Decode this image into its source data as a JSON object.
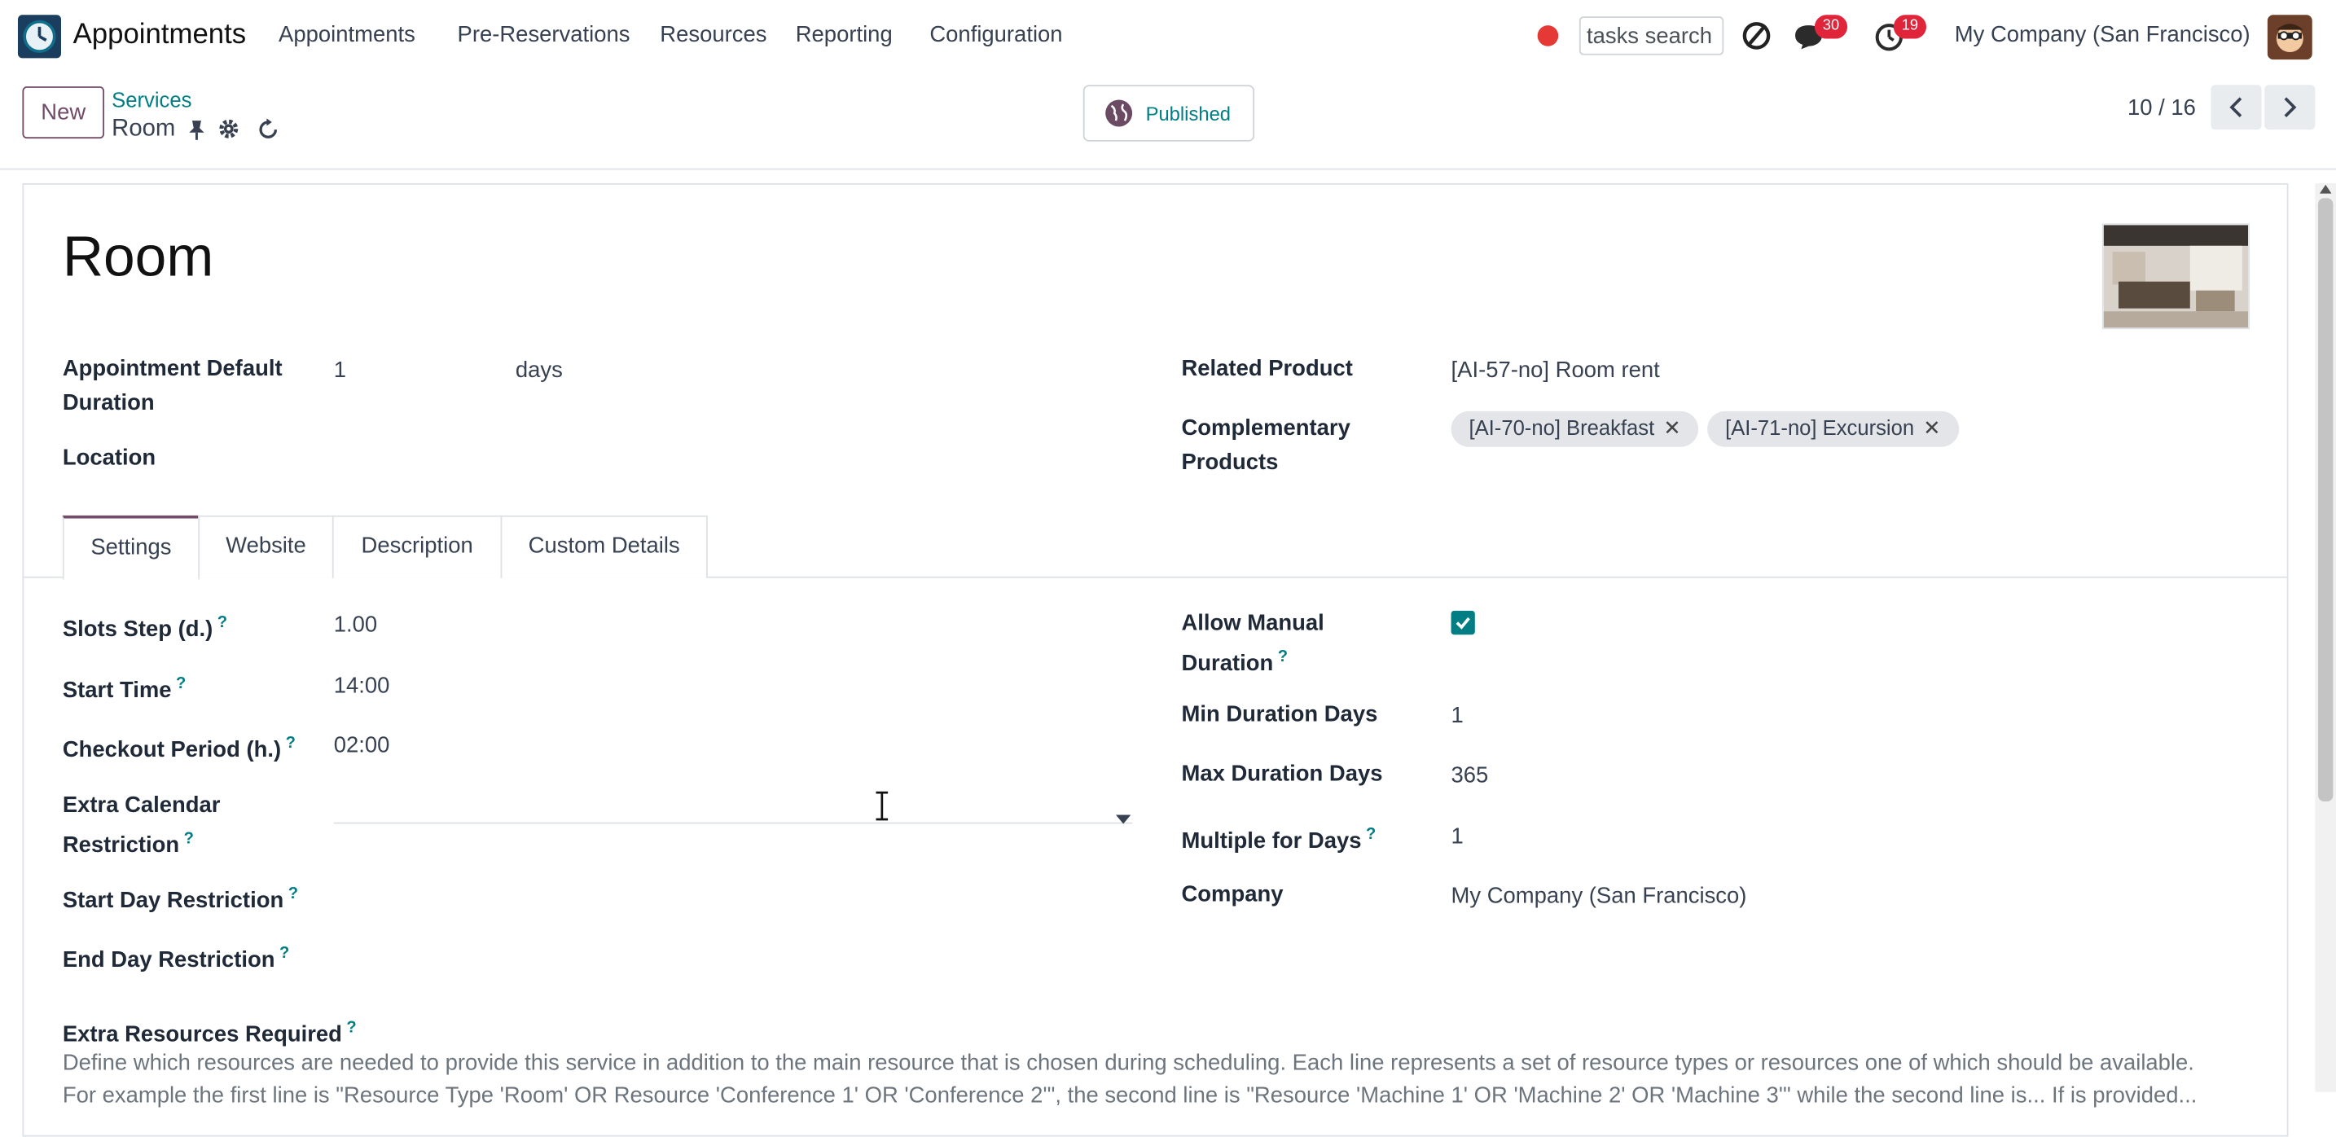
{
  "app": {
    "name": "Appointments",
    "menu": [
      "Appointments",
      "Pre-Reservations",
      "Resources",
      "Reporting",
      "Configuration"
    ],
    "search_value": "tasks search",
    "messages_count": "30",
    "activities_count": "19",
    "company": "My Company (San Francisco)"
  },
  "control": {
    "new_label": "New",
    "breadcrumb_parent": "Services",
    "breadcrumb_current": "Room",
    "published_label": "Published",
    "pager": "10 / 16"
  },
  "record": {
    "title": "Room",
    "left_fields": {
      "duration_label": "Appointment Default Duration",
      "duration_value": "1",
      "duration_unit": "days",
      "location_label": "Location"
    },
    "right_fields": {
      "related_product_label": "Related Product",
      "related_product_value": "[AI-57-no] Room rent",
      "complementary_label": "Complementary Products",
      "complementary_tags": [
        "[AI-70-no] Breakfast",
        "[AI-71-no] Excursion"
      ]
    }
  },
  "tabs": [
    "Settings",
    "Website",
    "Description",
    "Custom Details"
  ],
  "settings": {
    "left": [
      {
        "label": "Slots Step (d.)",
        "value": "1.00"
      },
      {
        "label": "Start Time",
        "value": "14:00"
      },
      {
        "label": "Checkout Period (h.)",
        "value": "02:00"
      },
      {
        "label": "Extra Calendar Restriction",
        "value": ""
      },
      {
        "label": "Start Day Restriction",
        "value": ""
      },
      {
        "label": "End Day Restriction",
        "value": ""
      }
    ],
    "right": [
      {
        "label": "Allow Manual Duration",
        "value": ""
      },
      {
        "label": "Min Duration Days",
        "value": "1"
      },
      {
        "label": "Max Duration Days",
        "value": "365"
      },
      {
        "label": "Multiple for Days",
        "value": "1"
      },
      {
        "label": "Company",
        "value": "My Company (San Francisco)"
      }
    ],
    "allow_manual_duration": true,
    "extra_resources_label": "Extra Resources Required",
    "extra_resources_description": "Define which resources are needed to provide this service in addition to the main resource that is chosen during scheduling. Each line represents a set of resource types or resources one of which should be available.",
    "extra_resources_description_cont": "For example the first line is \"Resource Type 'Room' OR Resource 'Conference 1' OR 'Conference 2'\", the second line is \"Resource 'Machine 1' OR 'Machine 2' OR 'Machine 3'\" while the second line is... If is provided..."
  },
  "colors": {
    "brand": "#714b67",
    "teal": "#017e84",
    "badge": "#e0243a"
  },
  "help_mark": "?"
}
